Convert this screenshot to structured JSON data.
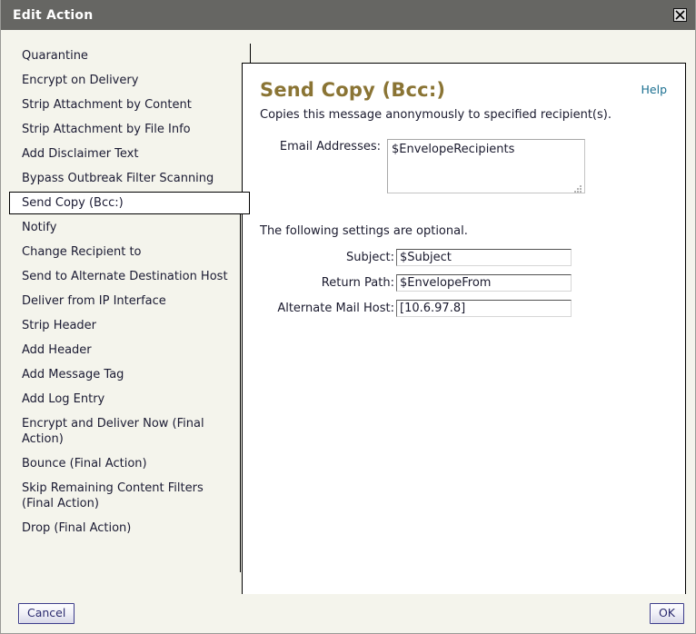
{
  "window": {
    "title": "Edit Action",
    "close_icon": "close-icon"
  },
  "sidebar": {
    "items": [
      {
        "label": "Quarantine",
        "selected": false
      },
      {
        "label": "Encrypt on Delivery",
        "selected": false
      },
      {
        "label": "Strip Attachment by Content",
        "selected": false
      },
      {
        "label": "Strip Attachment by File Info",
        "selected": false
      },
      {
        "label": "Add Disclaimer Text",
        "selected": false
      },
      {
        "label": "Bypass Outbreak Filter Scanning",
        "selected": false
      },
      {
        "label": "Send Copy (Bcc:)",
        "selected": true
      },
      {
        "label": "Notify",
        "selected": false
      },
      {
        "label": "Change Recipient to",
        "selected": false
      },
      {
        "label": "Send to Alternate Destination Host",
        "selected": false
      },
      {
        "label": "Deliver from IP Interface",
        "selected": false
      },
      {
        "label": "Strip Header",
        "selected": false
      },
      {
        "label": "Add Header",
        "selected": false
      },
      {
        "label": "Add Message Tag",
        "selected": false
      },
      {
        "label": "Add Log Entry",
        "selected": false
      },
      {
        "label": "Encrypt and Deliver Now (Final Action)",
        "selected": false
      },
      {
        "label": "Bounce (Final Action)",
        "selected": false
      },
      {
        "label": "Skip Remaining Content Filters (Final Action)",
        "selected": false
      },
      {
        "label": "Drop (Final Action)",
        "selected": false
      }
    ]
  },
  "panel": {
    "title": "Send Copy (Bcc:)",
    "help_label": "Help",
    "description": "Copies this message anonymously to specified recipient(s).",
    "email_label": "Email Addresses:",
    "email_value": "$EnvelopeRecipients",
    "optional_note": "The following settings are optional.",
    "fields": [
      {
        "label": "Subject:",
        "value": "$Subject"
      },
      {
        "label": "Return Path:",
        "value": "$EnvelopeFrom"
      },
      {
        "label": "Alternate Mail Host:",
        "value": "[10.6.97.8]"
      }
    ]
  },
  "footer": {
    "cancel_label": "Cancel",
    "ok_label": "OK"
  },
  "colors": {
    "titlebar": "#666663",
    "page_background": "#f4f4ec",
    "panel_title": "#8a7434",
    "help_link": "#1a6f90",
    "button_text": "#2a2a6e",
    "button_border": "#3c3c8c"
  }
}
